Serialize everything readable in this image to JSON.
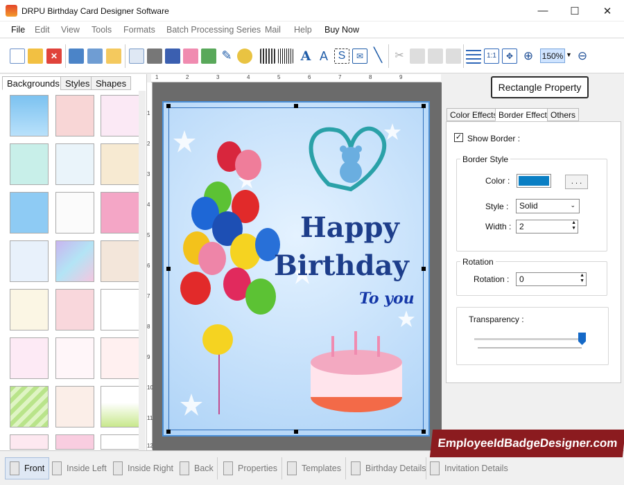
{
  "window": {
    "title": "DRPU Birthday Card Designer Software",
    "minimize": "—",
    "maximize": "☐",
    "close": "✕"
  },
  "menu": [
    "File",
    "Edit",
    "View",
    "Tools",
    "Formats",
    "Batch Processing Series",
    "Mail",
    "Help",
    "Buy Now"
  ],
  "toolbar": {
    "zoom": "150%",
    "one_to_one": "1:1"
  },
  "left_tabs": [
    "Backgrounds",
    "Styles",
    "Shapes"
  ],
  "card": {
    "line1": "Happy",
    "line2": "Birthday",
    "line3": "To you"
  },
  "rect_property": "Rectangle Property",
  "right_tabs": [
    "Color Effects",
    "Border Effect",
    "Others"
  ],
  "border": {
    "show_border_label": "Show Border :",
    "show_border": true,
    "group_title": "Border Style",
    "color_label": "Color :",
    "color_value": "#0a7fc4",
    "browse": ". . .",
    "style_label": "Style :",
    "style_value": "Solid",
    "width_label": "Width :",
    "width_value": "2",
    "rotation_group": "Rotation",
    "rotation_label": "Rotation :",
    "rotation_value": "0",
    "transparency_label": "Transparency :",
    "transparency_level": 1.0
  },
  "bottom_tabs": [
    "Front",
    "Inside Left",
    "Inside Right",
    "Back",
    "Properties",
    "Templates",
    "Birthday Details",
    "Invitation Details"
  ],
  "watermark": "EmployeeIdBadgeDesigner.com",
  "ruler_top": [
    "1",
    "2",
    "3",
    "4",
    "5",
    "6",
    "7",
    "8",
    "9"
  ],
  "ruler_left": [
    "1",
    "2",
    "3",
    "4",
    "5",
    "6",
    "7",
    "8",
    "9",
    "10",
    "11",
    "12"
  ]
}
